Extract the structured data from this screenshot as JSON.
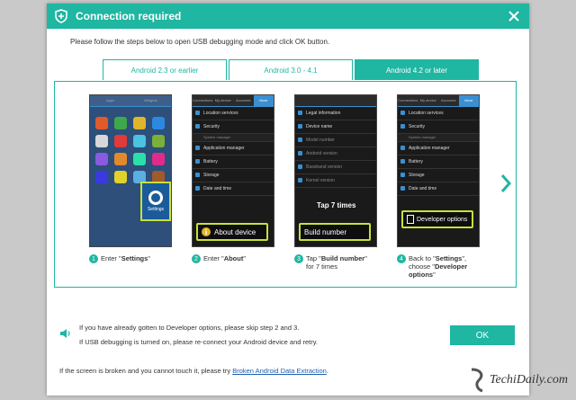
{
  "window": {
    "title": "Connection required"
  },
  "intro": "Please follow the steps below to open USB debugging mode and click OK button.",
  "tabs": [
    {
      "label": "Android 2.3 or earlier",
      "active": false
    },
    {
      "label": "Android 3.0 - 4.1",
      "active": false
    },
    {
      "label": "Android 4.2 or later",
      "active": true
    }
  ],
  "steps": [
    {
      "num": "1",
      "pre": "Enter \"",
      "bold": "Settings",
      "post": "\"",
      "callout": "Settings"
    },
    {
      "num": "2",
      "pre": "Enter \"",
      "bold": "About",
      "post": "\"",
      "callout": "About device"
    },
    {
      "num": "3",
      "pre": "Tap \"",
      "bold": "Build number",
      "post": "\" for 7 times",
      "callout": "Build number",
      "tap_label": "Tap 7 times"
    },
    {
      "num": "4",
      "pre": "Back to \"",
      "bold": "Settings",
      "post": "\", choose \"",
      "bold2": "Developer options",
      "post2": "\"",
      "callout": "Developer options"
    }
  ],
  "phone": {
    "tabs": [
      "Connections",
      "My device",
      "Accounts",
      "More"
    ],
    "menu": [
      "Location services",
      "Security",
      "System manager",
      "Application manager",
      "Battery",
      "Storage",
      "Date and time"
    ],
    "about_rows": [
      "Legal information",
      "Device name",
      "Model number",
      "Android version",
      "Baseband version",
      "Kernel version"
    ],
    "home_tabs": [
      "Apps",
      "Widgets"
    ]
  },
  "notes": {
    "line1": "If you have already gotten to Developer options, please skip step 2 and 3.",
    "line2": "If USB debugging is turned on, please re-connect your Android device and retry."
  },
  "ok_label": "OK",
  "footer": {
    "text": "If the screen is broken and you cannot touch it, please try ",
    "link": "Broken Android Data Extraction",
    "end": "."
  },
  "watermark": "TechiDaily.com",
  "colors": {
    "accent": "#1fb6a2",
    "highlight": "#c8e03a",
    "link": "#1f5fb0"
  }
}
